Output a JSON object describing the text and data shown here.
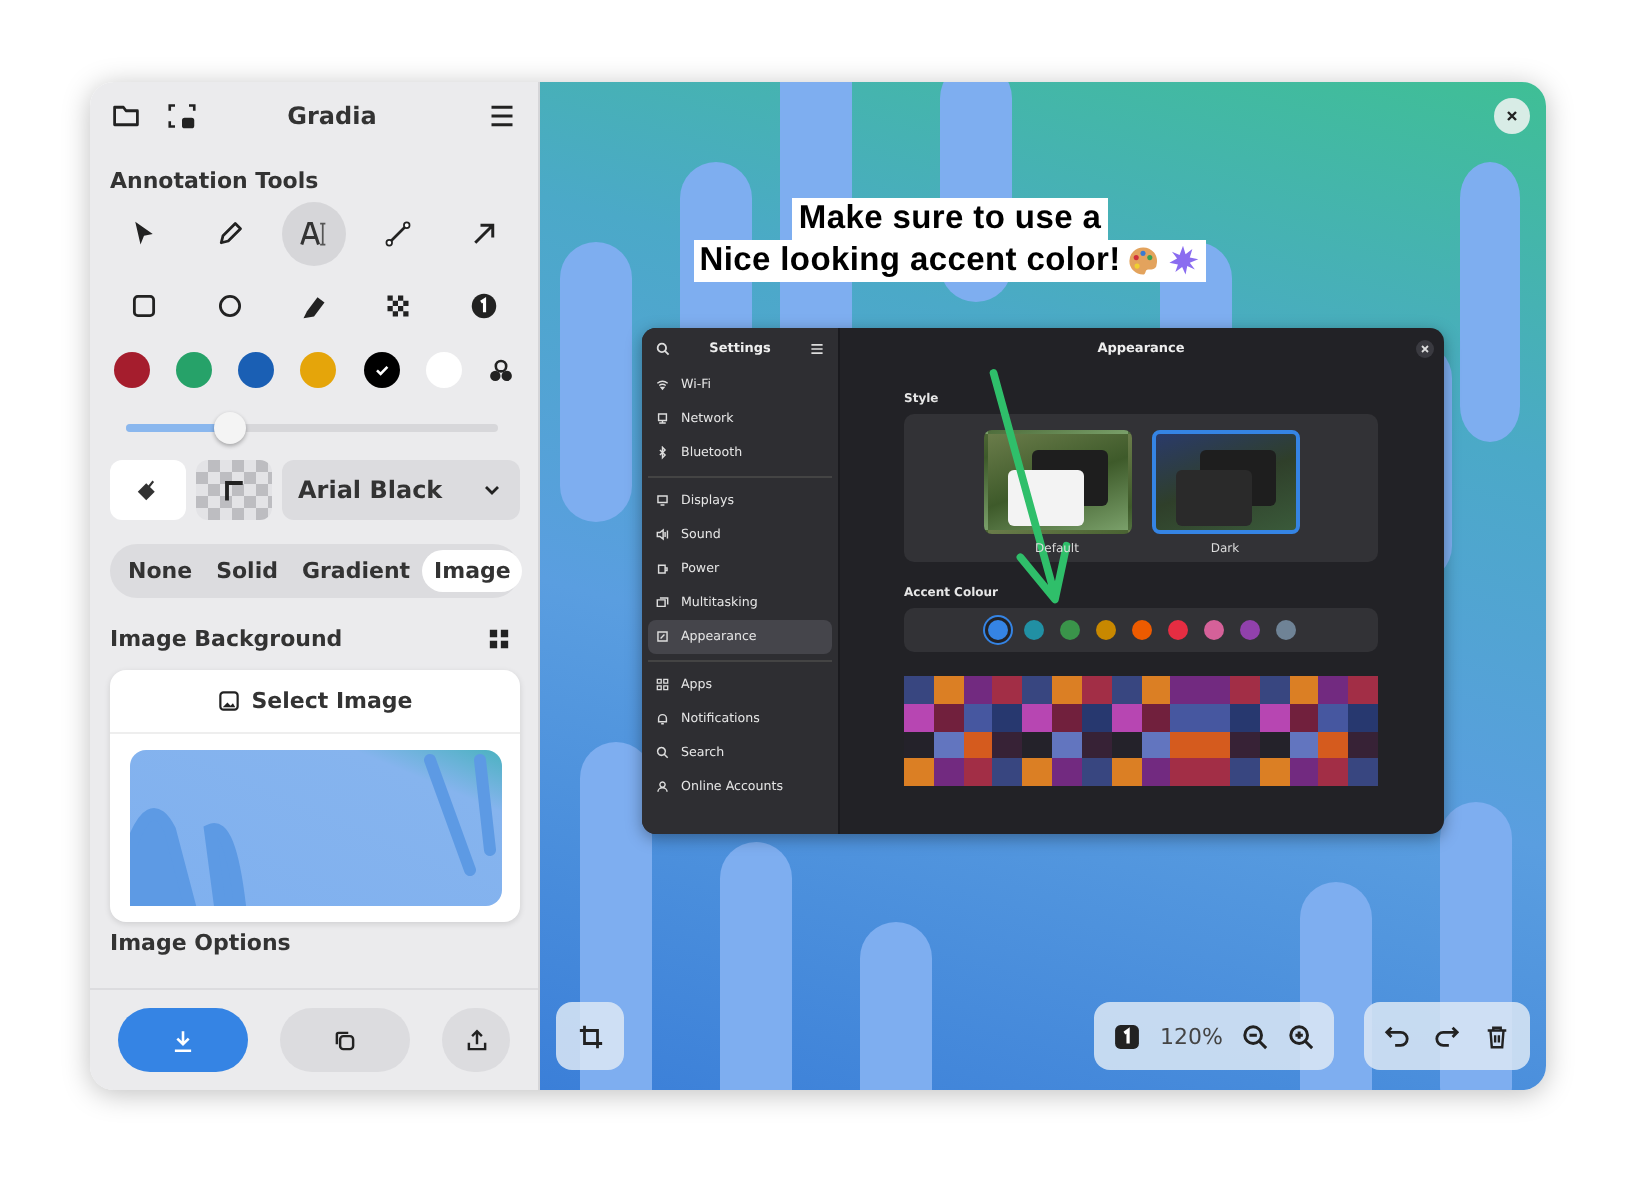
{
  "app": {
    "title": "Gradia"
  },
  "annotation_tools": {
    "heading": "Annotation Tools",
    "tools": [
      {
        "kind": "select",
        "selected": false
      },
      {
        "kind": "pen",
        "selected": false
      },
      {
        "kind": "text",
        "selected": true
      },
      {
        "kind": "line",
        "selected": false
      },
      {
        "kind": "arrow",
        "selected": false
      },
      {
        "kind": "rectangle",
        "selected": false
      },
      {
        "kind": "circle",
        "selected": false
      },
      {
        "kind": "highlighter",
        "selected": false
      },
      {
        "kind": "pixelate",
        "selected": false
      },
      {
        "kind": "number",
        "selected": false
      }
    ]
  },
  "colors": [
    {
      "color": "#a51d2d",
      "selected": false
    },
    {
      "color": "#26a269",
      "selected": false
    },
    {
      "color": "#1a5fb4",
      "selected": false
    },
    {
      "color": "#e5a50a",
      "selected": false
    },
    {
      "color": "#000000",
      "selected": true
    },
    {
      "color": "#ffffff",
      "selected": false
    }
  ],
  "size_slider": {
    "level": 0.28
  },
  "font_dropdown": {
    "value": "Arial Black"
  },
  "background_tabs": [
    {
      "label": "None",
      "selected": false
    },
    {
      "label": "Solid",
      "selected": false
    },
    {
      "label": "Gradient",
      "selected": false
    },
    {
      "label": "Image",
      "selected": true
    }
  ],
  "image_background": {
    "heading": "Image Background",
    "select_button": "Select Image"
  },
  "image_options": {
    "heading": "Image Options"
  },
  "annotation_text": [
    "Make sure to use a",
    "Nice looking accent color!"
  ],
  "settings_window": {
    "title": "Settings",
    "page_title": "Appearance",
    "sidebar": [
      {
        "label": "Wi-Fi",
        "kind": "wifi",
        "selected": false,
        "divider_after": false
      },
      {
        "label": "Network",
        "kind": "network",
        "selected": false,
        "divider_after": false
      },
      {
        "label": "Bluetooth",
        "kind": "bluetooth",
        "selected": false,
        "divider_after": true
      },
      {
        "label": "Displays",
        "kind": "display",
        "selected": false,
        "divider_after": false
      },
      {
        "label": "Sound",
        "kind": "sound",
        "selected": false,
        "divider_after": false
      },
      {
        "label": "Power",
        "kind": "power",
        "selected": false,
        "divider_after": false
      },
      {
        "label": "Multitasking",
        "kind": "multitasking",
        "selected": false,
        "divider_after": false
      },
      {
        "label": "Appearance",
        "kind": "appearance",
        "selected": true,
        "divider_after": true
      },
      {
        "label": "Apps",
        "kind": "apps",
        "selected": false,
        "divider_after": false
      },
      {
        "label": "Notifications",
        "kind": "bell",
        "selected": false,
        "divider_after": false
      },
      {
        "label": "Search",
        "kind": "search",
        "selected": false,
        "divider_after": false
      },
      {
        "label": "Online Accounts",
        "kind": "accounts",
        "selected": false,
        "divider_after": false
      }
    ],
    "style_heading": "Style",
    "styles": [
      {
        "label": "Default",
        "kind": "light",
        "selected": false
      },
      {
        "label": "Dark",
        "kind": "dark",
        "selected": true
      }
    ],
    "accent_heading": "Accent Colour",
    "accents": [
      {
        "color": "#3584e4",
        "selected": true
      },
      {
        "color": "#2190a4",
        "selected": false
      },
      {
        "color": "#3a944a",
        "selected": false
      },
      {
        "color": "#c88800",
        "selected": false
      },
      {
        "color": "#ed5b00",
        "selected": false
      },
      {
        "color": "#e62d42",
        "selected": false
      },
      {
        "color": "#d56199",
        "selected": false
      },
      {
        "color": "#9141ac",
        "selected": false
      },
      {
        "color": "#6f8396",
        "selected": false
      }
    ]
  },
  "zoom": {
    "value": "120%"
  }
}
